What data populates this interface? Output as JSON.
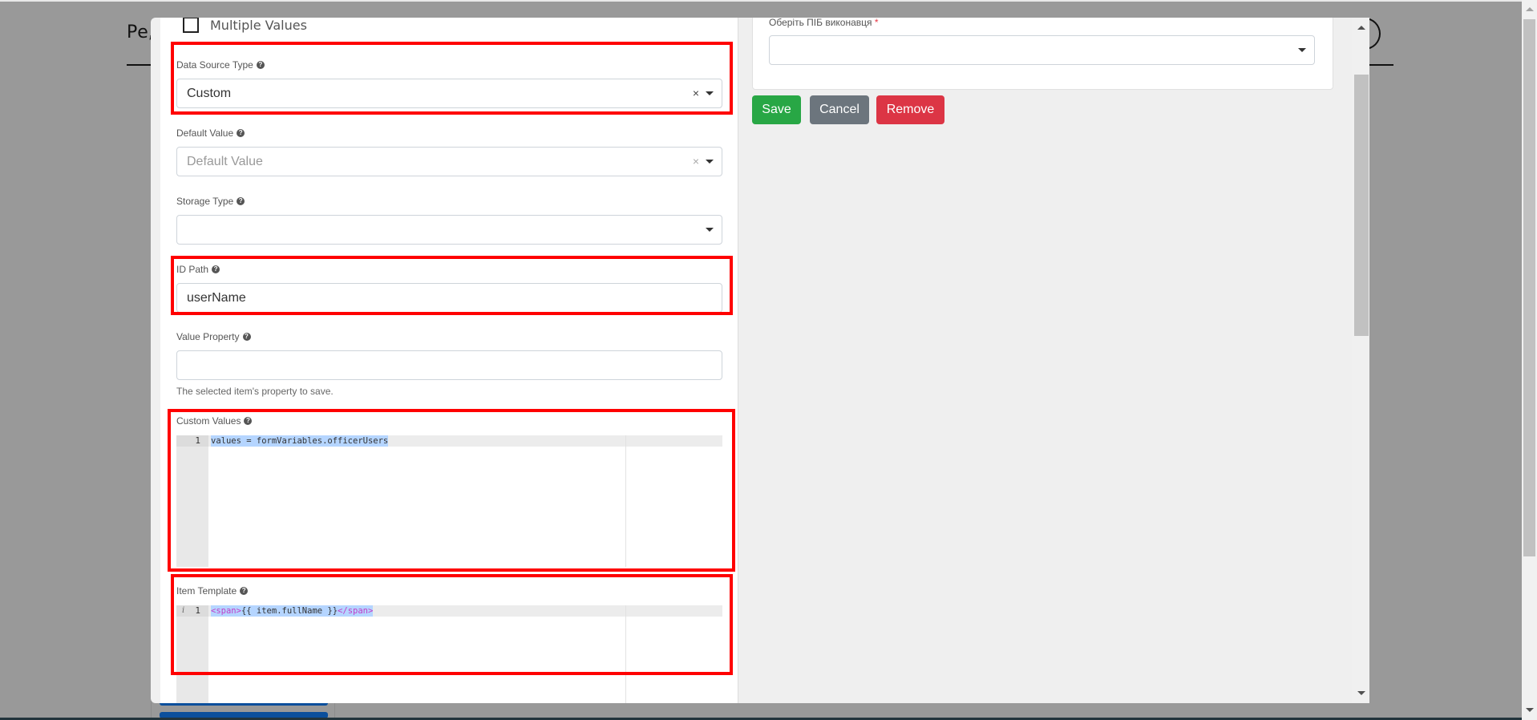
{
  "background": {
    "page_title_fragment": "Ре,"
  },
  "modal": {
    "multiple_values": {
      "label": "Multiple Values",
      "checked": false
    },
    "data_source_type": {
      "label": "Data Source Type",
      "value": "Custom",
      "help_icon": "question-circle-icon"
    },
    "default_value": {
      "label": "Default Value",
      "placeholder": "Default Value",
      "value": ""
    },
    "storage_type": {
      "label": "Storage Type",
      "value": ""
    },
    "id_path": {
      "label": "ID Path",
      "value": "userName"
    },
    "value_property": {
      "label": "Value Property",
      "value": "",
      "hint": "The selected item's property to save."
    },
    "custom_values": {
      "label": "Custom Values",
      "lines": [
        {
          "number": "1",
          "code": "values = formVariables.officerUsers"
        }
      ]
    },
    "item_template": {
      "label": "Item Template",
      "lines": [
        {
          "number": "1",
          "info_marker": "i",
          "open_tag": "<span>",
          "expr": "{{ item.fullName }}",
          "close_tag": "</span>"
        }
      ]
    },
    "preview": {
      "select_label": "Оберіть ПІБ виконавця",
      "required_mark": "*",
      "select_value": ""
    },
    "buttons": {
      "save": "Save",
      "cancel": "Cancel",
      "remove": "Remove"
    },
    "highlight_color": "#ff0000"
  },
  "icons": {
    "clear": "×",
    "help": "?"
  }
}
